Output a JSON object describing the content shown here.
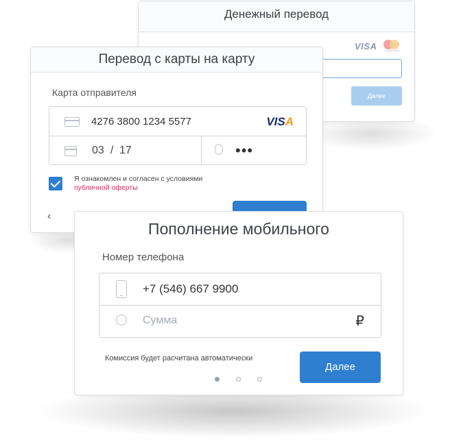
{
  "back_card": {
    "title": "Денежный перевод",
    "visa_label": "VISA",
    "mastercard_label": "mastercard",
    "next_label": "Далее"
  },
  "middle_card": {
    "title": "Перевод с карты на карту",
    "sender_label": "Карта отправителя",
    "card_number": "4276 3800 1234 5577",
    "card_brand": "VISA",
    "exp_month": "03",
    "exp_separator": "/",
    "exp_year": "17",
    "cvv_masked": "•••",
    "agree_text": "Я ознакомлен и согласен с условиями",
    "agree_link": "публичной оферты",
    "agree_checked": true,
    "back_icon": "chevron-left-icon"
  },
  "front_card": {
    "title": "Пополнение мобильного",
    "phone_label": "Номер телефона",
    "phone_value": "+7 (546) 667 9900",
    "amount_placeholder": "Сумма",
    "currency": "₽",
    "commission_note": "Комиссия будет расчитана автоматически",
    "next_label": "Далее",
    "carousel": {
      "count": 3,
      "active_index": 0
    }
  },
  "colors": {
    "accent": "#2f7fd1",
    "accent_disabled": "#a9cdef",
    "link": "#e0245e",
    "border": "#cfd4d9"
  }
}
